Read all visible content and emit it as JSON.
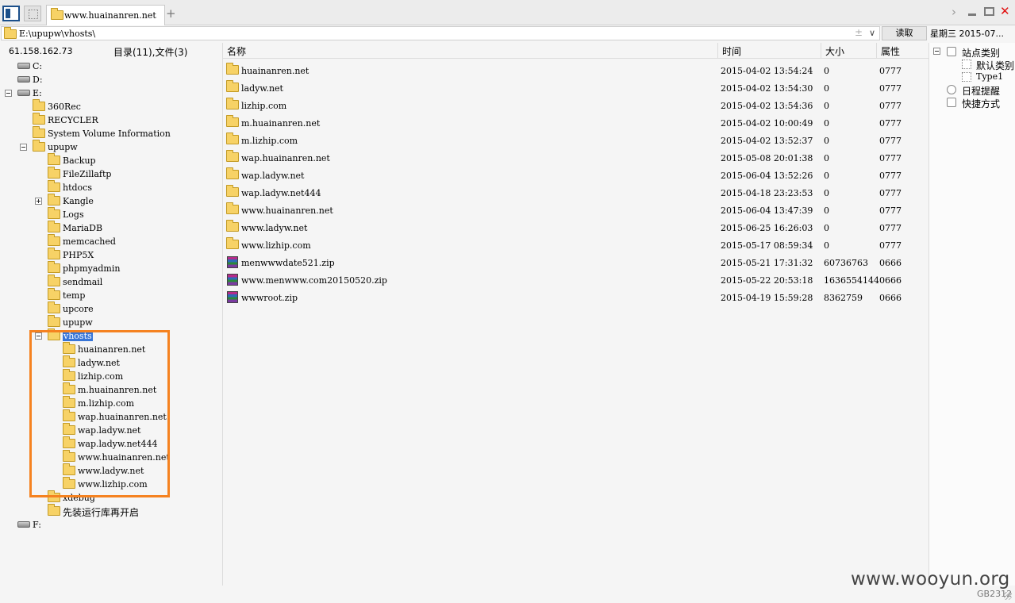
{
  "tab": {
    "title": "www.huainanren.net",
    "add": "+"
  },
  "window": {
    "nav_forward": "›",
    "close": "✕"
  },
  "address": {
    "path": "E:\\upupw\\vhosts\\",
    "favorite": "±",
    "dropdown": "∨",
    "read_button": "读取"
  },
  "datetime": "星期三  2015-07...",
  "left": {
    "ip": "61.158.162.73",
    "count": "目录(11),文件(3)",
    "tree": [
      {
        "label": "C:",
        "kind": "drive"
      },
      {
        "label": "D:",
        "kind": "drive"
      },
      {
        "label": "E:",
        "kind": "drive"
      },
      {
        "label": "360Rec",
        "kind": "folder"
      },
      {
        "label": "RECYCLER",
        "kind": "folder"
      },
      {
        "label": "System Volume Information",
        "kind": "folder"
      },
      {
        "label": "upupw",
        "kind": "folder"
      },
      {
        "label": "Backup",
        "kind": "folder"
      },
      {
        "label": "FileZillaftp",
        "kind": "folder"
      },
      {
        "label": "htdocs",
        "kind": "folder"
      },
      {
        "label": "Kangle",
        "kind": "folder"
      },
      {
        "label": "Logs",
        "kind": "folder"
      },
      {
        "label": "MariaDB",
        "kind": "folder"
      },
      {
        "label": "memcached",
        "kind": "folder"
      },
      {
        "label": "PHP5X",
        "kind": "folder"
      },
      {
        "label": "phpmyadmin",
        "kind": "folder"
      },
      {
        "label": "sendmail",
        "kind": "folder"
      },
      {
        "label": "temp",
        "kind": "folder"
      },
      {
        "label": "upcore",
        "kind": "folder"
      },
      {
        "label": "upupw",
        "kind": "folder"
      },
      {
        "label": "vhosts",
        "kind": "folder",
        "selected": true
      },
      {
        "label": "huainanren.net",
        "kind": "folder"
      },
      {
        "label": "ladyw.net",
        "kind": "folder"
      },
      {
        "label": "lizhip.com",
        "kind": "folder"
      },
      {
        "label": "m.huainanren.net",
        "kind": "folder"
      },
      {
        "label": "m.lizhip.com",
        "kind": "folder"
      },
      {
        "label": "wap.huainanren.net",
        "kind": "folder"
      },
      {
        "label": "wap.ladyw.net",
        "kind": "folder"
      },
      {
        "label": "wap.ladyw.net444",
        "kind": "folder"
      },
      {
        "label": "www.huainanren.net",
        "kind": "folder"
      },
      {
        "label": "www.ladyw.net",
        "kind": "folder"
      },
      {
        "label": "www.lizhip.com",
        "kind": "folder"
      },
      {
        "label": "xdebug",
        "kind": "folder"
      },
      {
        "label": "先装运行库再开启",
        "kind": "folder"
      },
      {
        "label": "F:",
        "kind": "drive"
      }
    ]
  },
  "columns": {
    "name": "名称",
    "time": "时间",
    "size": "大小",
    "attr": "属性"
  },
  "files": [
    {
      "name": "huainanren.net",
      "time": "2015-04-02 13:54:24",
      "size": "0",
      "attr": "0777",
      "type": "folder"
    },
    {
      "name": "ladyw.net",
      "time": "2015-04-02 13:54:30",
      "size": "0",
      "attr": "0777",
      "type": "folder"
    },
    {
      "name": "lizhip.com",
      "time": "2015-04-02 13:54:36",
      "size": "0",
      "attr": "0777",
      "type": "folder"
    },
    {
      "name": "m.huainanren.net",
      "time": "2015-04-02 10:00:49",
      "size": "0",
      "attr": "0777",
      "type": "folder"
    },
    {
      "name": "m.lizhip.com",
      "time": "2015-04-02 13:52:37",
      "size": "0",
      "attr": "0777",
      "type": "folder"
    },
    {
      "name": "wap.huainanren.net",
      "time": "2015-05-08 20:01:38",
      "size": "0",
      "attr": "0777",
      "type": "folder"
    },
    {
      "name": "wap.ladyw.net",
      "time": "2015-06-04 13:52:26",
      "size": "0",
      "attr": "0777",
      "type": "folder"
    },
    {
      "name": "wap.ladyw.net444",
      "time": "2015-04-18 23:23:53",
      "size": "0",
      "attr": "0777",
      "type": "folder"
    },
    {
      "name": "www.huainanren.net",
      "time": "2015-06-04 13:47:39",
      "size": "0",
      "attr": "0777",
      "type": "folder"
    },
    {
      "name": "www.ladyw.net",
      "time": "2015-06-25 16:26:03",
      "size": "0",
      "attr": "0777",
      "type": "folder"
    },
    {
      "name": "www.lizhip.com",
      "time": "2015-05-17 08:59:34",
      "size": "0",
      "attr": "0777",
      "type": "folder"
    },
    {
      "name": "menwwwdate521.zip",
      "time": "2015-05-21 17:31:32",
      "size": "60736763",
      "attr": "0666",
      "type": "zip"
    },
    {
      "name": "www.menwww.com20150520.zip",
      "time": "2015-05-22 20:53:18",
      "size": "1636554144",
      "attr": "0666",
      "type": "zip"
    },
    {
      "name": "wwwroot.zip",
      "time": "2015-04-19 15:59:28",
      "size": "8362759",
      "attr": "0666",
      "type": "zip"
    }
  ],
  "right": {
    "site_category": "站点类别",
    "default_category": "默认类别",
    "type1": "Type1",
    "schedule": "日程提醒",
    "shortcut": "快捷方式"
  },
  "watermark": "www.wooyun.org",
  "encoding": "GB2312",
  "colors": {
    "highlight_border": "#f58220",
    "selection": "#3875d7",
    "close": "#e01010"
  }
}
